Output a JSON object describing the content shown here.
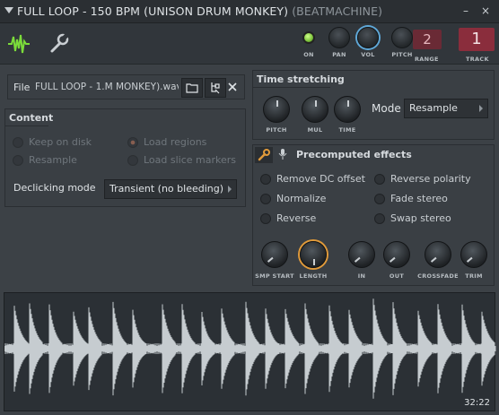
{
  "window": {
    "title": "FULL LOOP - 150 BPM (UNISON DRUM MONKEY)",
    "subtitle": "(BEATMACHINE)",
    "close_glyph": "×",
    "min_glyph": "–"
  },
  "toolbar": {
    "on_label": "ON",
    "pan_label": "PAN",
    "vol_label": "VOL",
    "pitch_label": "PITCH",
    "range_label": "RANGE",
    "range_value": "2",
    "track_label": "TRACK",
    "track_value": "1",
    "accent_green": "#7bc23a",
    "vol_ring": "#5fa8d8"
  },
  "file": {
    "label": "File",
    "name": "FULL LOOP - 1.M MONKEY).wav",
    "open_icon": "folder-icon",
    "browse_icon": "browse-icon",
    "clear_icon": "close-icon"
  },
  "content": {
    "title": "Content",
    "options": [
      {
        "label": "Keep on disk",
        "checked": false
      },
      {
        "label": "Load regions",
        "checked": true
      },
      {
        "label": "Resample",
        "checked": false
      },
      {
        "label": "Load slice markers",
        "checked": false
      }
    ],
    "declicking_label": "Declicking mode",
    "declicking_value": "Transient (no bleeding)"
  },
  "time_stretching": {
    "title": "Time stretching",
    "knobs": [
      "PITCH",
      "MUL",
      "TIME"
    ],
    "mode_label": "Mode",
    "mode_value": "Resample"
  },
  "precomputed": {
    "title": "Precomputed effects",
    "left_options": [
      "Remove DC offset",
      "Normalize",
      "Reverse"
    ],
    "right_options": [
      "Reverse polarity",
      "Fade stereo",
      "Swap stereo"
    ],
    "knobs": [
      "SMP START",
      "LENGTH",
      "IN",
      "OUT",
      "CROSSFADE",
      "TRIM"
    ],
    "accent_orange": "#e09a3a"
  },
  "waveform": {
    "counter": "32:22",
    "color": "#c6ccd0"
  }
}
